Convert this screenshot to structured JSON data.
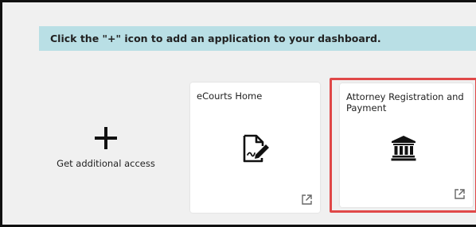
{
  "banner": {
    "text": "Click the \"+\" icon to add an application to your dashboard."
  },
  "add_tile": {
    "icon": "plus-icon",
    "label": "Get additional access"
  },
  "apps": [
    {
      "title": "eCourts Home",
      "icon": "document-signature-icon",
      "link_icon": "external-link-icon"
    },
    {
      "title": "Attorney Registration and Payment",
      "icon": "courthouse-icon",
      "link_icon": "external-link-icon",
      "highlighted": true
    }
  ],
  "colors": {
    "banner_bg": "#b9dfe5",
    "page_bg": "#f0f0f0",
    "highlight": "#e04848"
  }
}
